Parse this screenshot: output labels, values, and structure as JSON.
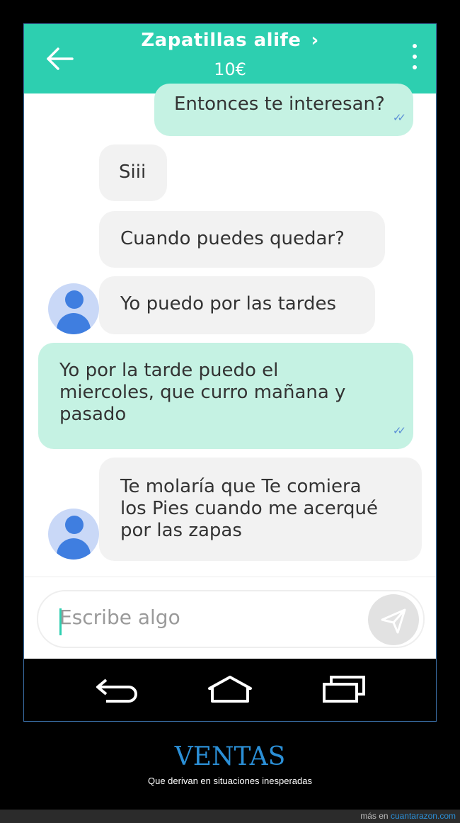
{
  "header": {
    "title": "Zapatillas alife",
    "chevron": "›",
    "price": "10€",
    "back_icon": "arrow-left-icon",
    "menu_icon": "vertical-dots-icon",
    "accent": "#2dcfb0"
  },
  "messages": [
    {
      "side": "out",
      "text": "Entonces te interesan?",
      "status": "read"
    },
    {
      "side": "in",
      "text": "Siii"
    },
    {
      "side": "in",
      "text": "Cuando puedes quedar?"
    },
    {
      "side": "in",
      "text": "Yo puedo por las tardes"
    },
    {
      "side": "out",
      "lines": [
        "Yo por la tarde puedo el",
        "miercoles, que curro mañana y",
        "pasado"
      ],
      "status": "read"
    },
    {
      "side": "in",
      "lines": [
        "Te molaría que Te comiera",
        "los Pies cuando me acerqué",
        "por las zapas"
      ]
    }
  ],
  "composer": {
    "placeholder": "Escribe algo",
    "send_icon": "paper-plane-icon"
  },
  "nav": {
    "back_icon": "back-icon",
    "home_icon": "home-icon",
    "recents_icon": "recents-icon"
  },
  "caption": {
    "title": "VENTAS",
    "subtitle": "Que derivan en situaciones inesperadas"
  },
  "footer": {
    "prefix": "más en",
    "site": "cuantarazon.com"
  },
  "colors": {
    "incoming_bubble": "#f2f2f2",
    "outgoing_bubble": "#c5f2e3",
    "read_ticks": "#5b8fd6",
    "caption": "#2b8fd6"
  }
}
